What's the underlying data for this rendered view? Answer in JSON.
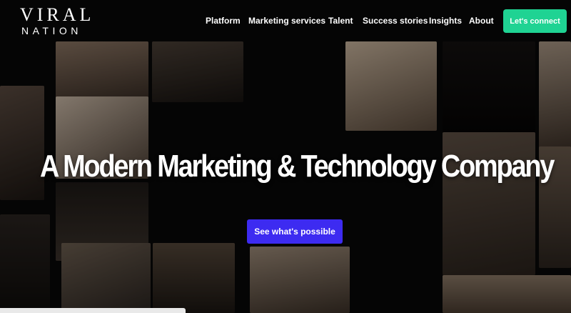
{
  "brand": {
    "logo_line1": "VIRAL",
    "logo_line2": "NATION"
  },
  "nav": {
    "items": [
      {
        "label": "Platform"
      },
      {
        "label": "Marketing services"
      },
      {
        "label": "Talent"
      },
      {
        "label": "Success stories"
      },
      {
        "label": "Insights"
      },
      {
        "label": "About"
      }
    ],
    "cta_label": "Let's connect"
  },
  "hero": {
    "title": "A Modern Marketing & Technology Company",
    "button_label": "See what's possible"
  },
  "colors": {
    "background": "#000000",
    "cta_green": "#1fd393",
    "hero_button_blue": "#3d2bf1"
  }
}
